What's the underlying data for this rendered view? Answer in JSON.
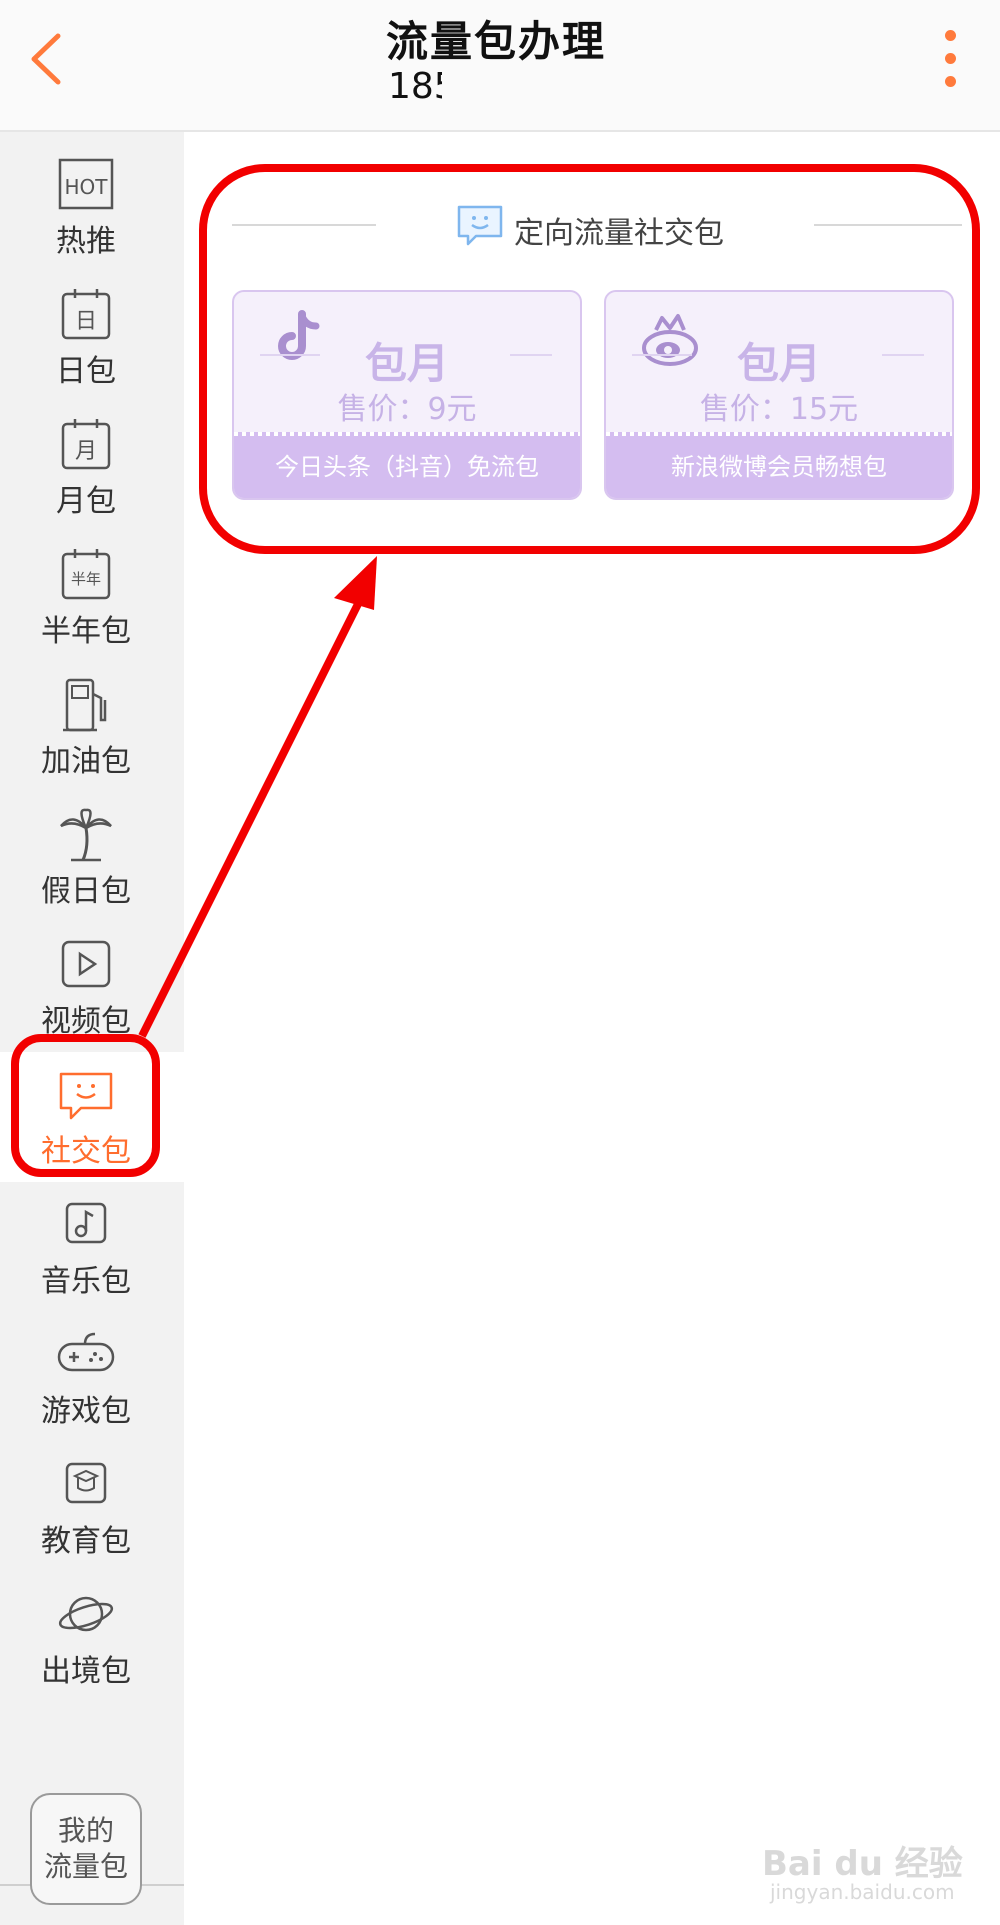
{
  "header": {
    "title": "流量包办理",
    "subtitle": "185"
  },
  "sidebar": {
    "items": [
      {
        "label": "热推",
        "icon": "hot-icon"
      },
      {
        "label": "日包",
        "icon": "day-calendar-icon"
      },
      {
        "label": "月包",
        "icon": "month-calendar-icon"
      },
      {
        "label": "半年包",
        "icon": "half-year-calendar-icon"
      },
      {
        "label": "加油包",
        "icon": "fuel-pump-icon"
      },
      {
        "label": "假日包",
        "icon": "palm-tree-icon"
      },
      {
        "label": "视频包",
        "icon": "play-icon"
      },
      {
        "label": "社交包",
        "icon": "chat-bubble-icon",
        "active": true
      },
      {
        "label": "音乐包",
        "icon": "music-note-icon"
      },
      {
        "label": "游戏包",
        "icon": "gamepad-icon"
      },
      {
        "label": "教育包",
        "icon": "graduation-cap-icon"
      },
      {
        "label": "出境包",
        "icon": "planet-icon"
      }
    ],
    "my_flow_line1": "我的",
    "my_flow_line2": "流量包"
  },
  "main": {
    "section_title": "定向流量社交包",
    "packages": [
      {
        "name": "包月",
        "price": "售价：9元",
        "description": "今日头条（抖音）免流包",
        "icon": "tiktok-icon"
      },
      {
        "name": "包月",
        "price": "售价：15元",
        "description": "新浪微博会员畅想包",
        "icon": "weibo-icon"
      }
    ]
  },
  "watermark": {
    "brand": "Bai du 经验",
    "url": "jingyan.baidu.com"
  },
  "colors": {
    "accent": "#ff6d2e",
    "annotation_red": "#f20000",
    "package_purple": "#d4bdf0"
  }
}
